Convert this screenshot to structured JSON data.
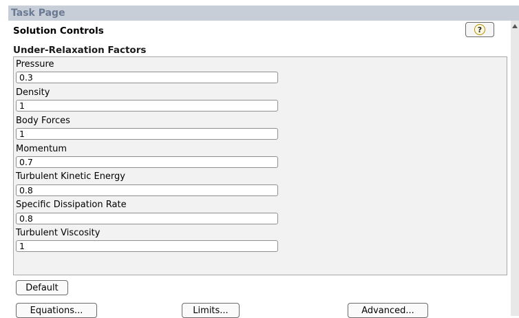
{
  "task_page": {
    "title": "Task Page"
  },
  "panel": {
    "title": "Solution Controls",
    "help_icon": "?"
  },
  "under_relaxation": {
    "title": "Under-Relaxation Factors",
    "fields": [
      {
        "label": "Pressure",
        "value": "0.3"
      },
      {
        "label": "Density",
        "value": "1"
      },
      {
        "label": "Body Forces",
        "value": "1"
      },
      {
        "label": "Momentum",
        "value": "0.7"
      },
      {
        "label": "Turbulent Kinetic Energy",
        "value": "0.8"
      },
      {
        "label": "Specific Dissipation Rate",
        "value": "0.8"
      },
      {
        "label": "Turbulent Viscosity",
        "value": "1"
      }
    ]
  },
  "buttons": {
    "default": "Default",
    "equations": "Equations...",
    "limits": "Limits...",
    "advanced": "Advanced..."
  },
  "icons": {
    "help": "help-icon",
    "scroll_up": "scroll-up-arrow-icon"
  }
}
